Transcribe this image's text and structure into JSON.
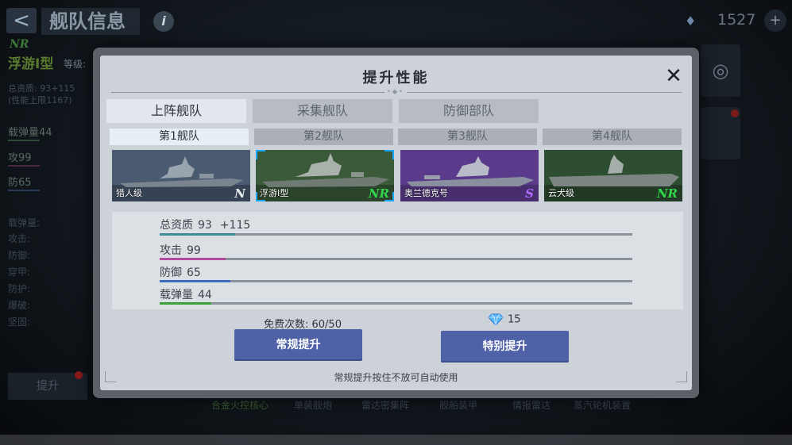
{
  "background": {
    "back_icon": "<",
    "title": "舰队信息",
    "info_icon": "i",
    "gem_icon": "♦",
    "currency_value": "1527",
    "plus_icon": "+",
    "ship_grade_badge": "NR",
    "ship_name": "浮游I型",
    "level_label": "等级:",
    "total_quality": "总资质: 93+115",
    "quality_cap": "(性能上限1167)",
    "stats": [
      "载弹量44",
      "攻99",
      "防65"
    ],
    "attributes": [
      "载弹量:",
      "攻击:",
      "防御:",
      "穿甲:",
      "防护:",
      "爆破:",
      "坚固:"
    ],
    "upgrade_label": "提升",
    "equipment_tabs": [
      "合金火控核心",
      "单装舰炮",
      "雷达密集阵",
      "舰船装甲",
      "情报雷达",
      "蒸汽轮机装置"
    ]
  },
  "modal": {
    "title": "提升性能",
    "close_icon": "✕",
    "categories": [
      {
        "label": "上阵舰队",
        "active": true
      },
      {
        "label": "采集舰队",
        "active": false
      },
      {
        "label": "防御部队",
        "active": false
      }
    ],
    "fleets": [
      {
        "label": "第1舰队",
        "active": true
      },
      {
        "label": "第2舰队",
        "active": false
      },
      {
        "label": "第3舰队",
        "active": false
      },
      {
        "label": "第4舰队",
        "active": false
      }
    ],
    "ships": [
      {
        "name": "猎人级",
        "grade": "N",
        "grade_color": "#e8ecef",
        "bg": "#4a5a70",
        "selected": false
      },
      {
        "name": "浮游I型",
        "grade": "NR",
        "grade_color": "#2fd64a",
        "bg": "#3a5a3a",
        "selected": true
      },
      {
        "name": "奥兰德克号",
        "grade": "S",
        "grade_color": "#b06bff",
        "bg": "#5a3a8a",
        "selected": false
      },
      {
        "name": "云犬级",
        "grade": "NR",
        "grade_color": "#2fd64a",
        "bg": "#2e4e32",
        "selected": false
      }
    ],
    "stats": [
      {
        "label": "总资质",
        "value": "93",
        "bonus": "+115",
        "fill": 0.16,
        "color": "#3f8a96"
      },
      {
        "label": "攻击",
        "value": "99",
        "fill": 0.14,
        "color": "#b24aa0"
      },
      {
        "label": "防御",
        "value": "65",
        "fill": 0.15,
        "color": "#3a6cc0"
      },
      {
        "label": "载弹量",
        "value": "44",
        "fill": 0.11,
        "color": "#3aa03a"
      }
    ],
    "free_count_label": "免费次数: 60/50",
    "cost_icon": "diamond-gem",
    "cost_value": "15",
    "btn_normal": "常规提升",
    "btn_special": "特别提升",
    "hint": "常规提升按住不放可自动使用"
  }
}
